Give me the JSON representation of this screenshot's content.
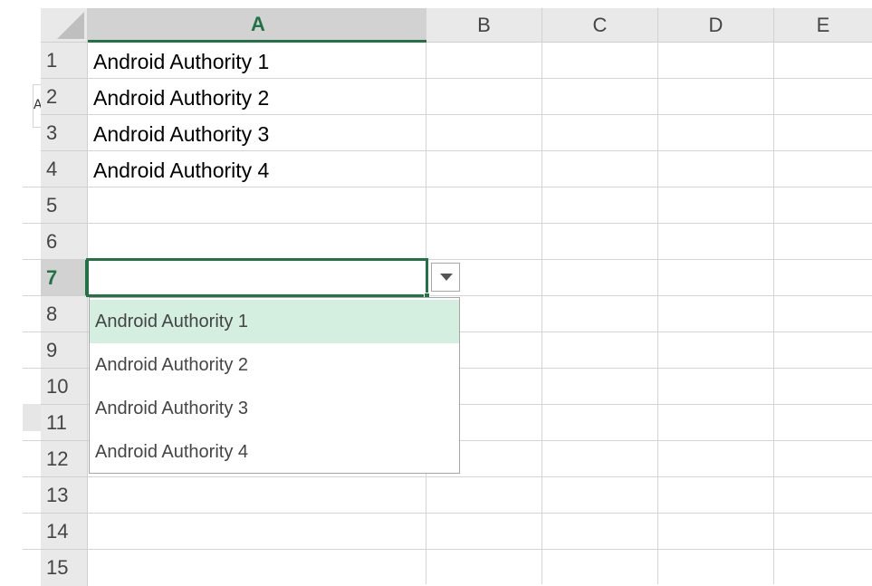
{
  "columns": [
    "A",
    "B",
    "C",
    "D",
    "E"
  ],
  "rows": [
    "1",
    "2",
    "3",
    "4",
    "5",
    "6",
    "7",
    "8",
    "9",
    "10",
    "11",
    "12",
    "13",
    "14",
    "15"
  ],
  "active_row": "7",
  "active_column": "A",
  "cells": {
    "A1": "Android Authority 1",
    "A2": "Android Authority 2",
    "A3": "Android Authority 3",
    "A4": "Android Authority 4"
  },
  "dropdown": {
    "selected": "Android Authority 1",
    "options": [
      "Android Authority 1",
      "Android Authority 2",
      "Android Authority 3",
      "Android Authority 4"
    ]
  },
  "stub_text": "A",
  "colors": {
    "accent": "#217346",
    "highlight": "#d4eedf",
    "header_bg": "#e9e9e9"
  },
  "icons": [
    "select-all-corner-icon",
    "dropdown-arrow-icon"
  ]
}
